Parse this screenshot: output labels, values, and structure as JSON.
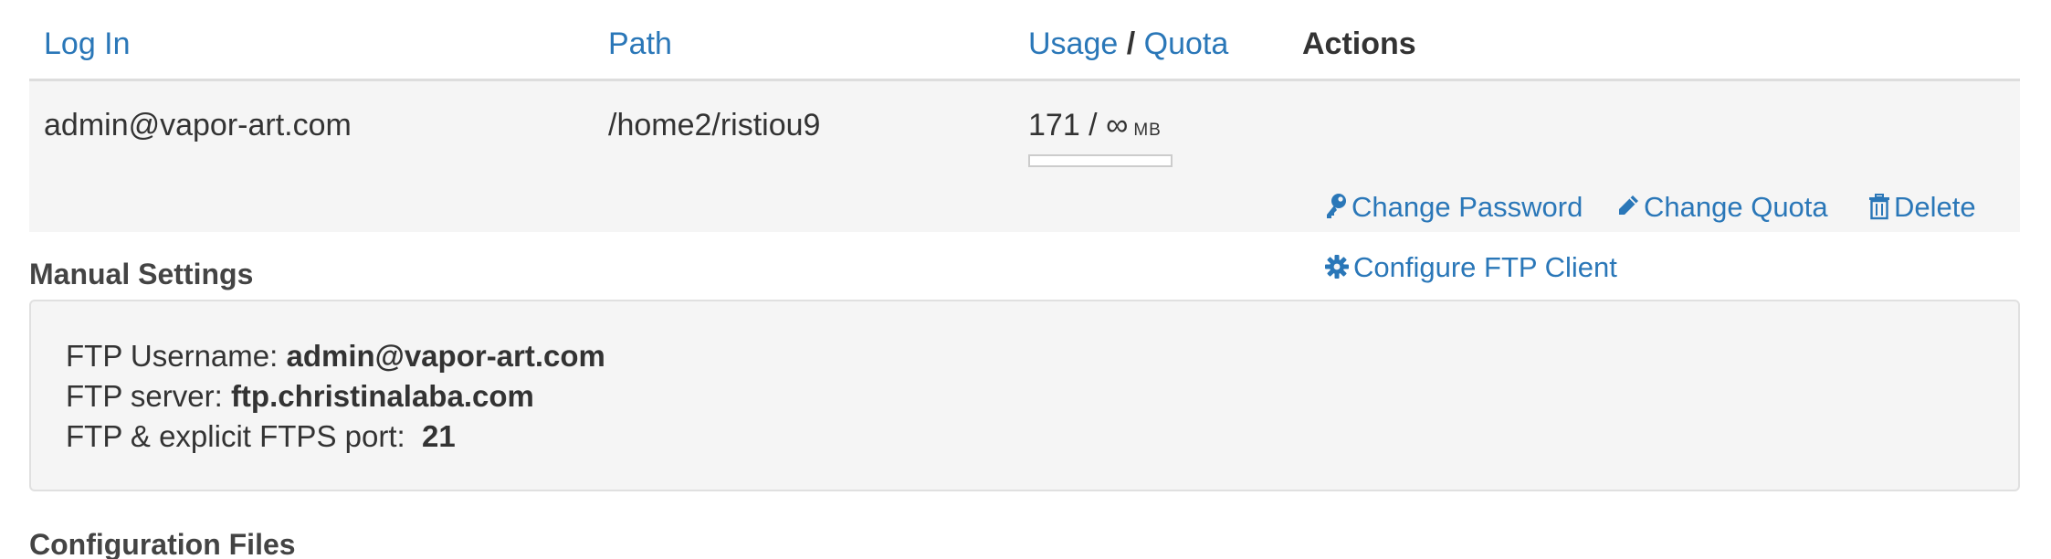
{
  "table": {
    "headers": {
      "login": "Log In",
      "path": "Path",
      "usage": "Usage",
      "slash": "/",
      "quota": "Quota",
      "actions": "Actions"
    },
    "row": {
      "login": "admin@vapor-art.com",
      "path": "/home2/ristiou9",
      "usage_text": "171 / ∞",
      "usage_unit": "MB",
      "usage_fraction": 0,
      "actions": {
        "change_password": "Change Password",
        "change_quota": "Change Quota",
        "delete": "Delete",
        "configure_ftp": "Configure FTP Client"
      }
    }
  },
  "manual_settings": {
    "title": "Manual Settings",
    "username_label": "FTP Username:",
    "username_value": "admin@vapor-art.com",
    "server_label": "FTP server:",
    "server_value": "ftp.christinalaba.com",
    "port_label": "FTP & explicit FTPS port:",
    "port_value": "21"
  },
  "configuration_files": {
    "title": "Configuration Files"
  },
  "icons": {
    "change_password": "key-icon",
    "change_quota": "pencil-icon",
    "delete": "trash-icon",
    "configure_ftp": "gear-icon"
  },
  "colors": {
    "link": "#2a77b8",
    "text": "#333333",
    "row_bg": "#f5f5f5"
  }
}
